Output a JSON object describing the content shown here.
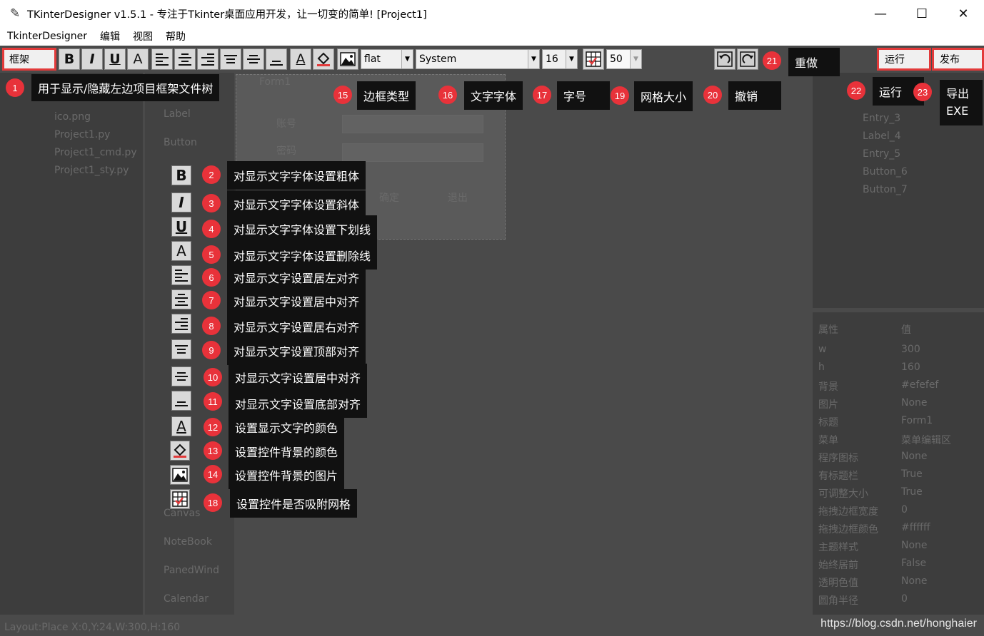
{
  "window": {
    "title": "TKinterDesigner v1.5.1 - 专注于Tkinter桌面应用开发，让一切变的简单!   [Project1]",
    "minimize": "—",
    "maximize": "☐",
    "close": "✕"
  },
  "menu": [
    "TkinterDesigner",
    "编辑",
    "视图",
    "帮助"
  ],
  "toolbar": {
    "frame_btn": "框架",
    "bold": "B",
    "italic": "I",
    "underline": "U",
    "strike": "A",
    "font_color": "A",
    "border_value": "flat",
    "font_value": "System",
    "size_value": "16",
    "grid_value": "50",
    "run_btn": "运行",
    "publish_btn": "发布"
  },
  "form": {
    "title": "Form1",
    "account_label": "账号",
    "password_label": "密码",
    "ok_btn": "确定",
    "exit_btn": "退出"
  },
  "left_tree": [
    "ico.png",
    "Project1.py",
    "Project1_cmd.py",
    "Project1_sty.py"
  ],
  "widgets": [
    "Label",
    "Button",
    "Canvas",
    "NoteBook",
    "PanedWind",
    "Calendar"
  ],
  "right_tree": [
    "Entry_3",
    "Label_4",
    "Entry_5",
    "Button_6",
    "Button_7"
  ],
  "properties": {
    "header_name": "属性",
    "header_value": "值",
    "rows": [
      {
        "k": "w",
        "v": "300"
      },
      {
        "k": "h",
        "v": "160"
      },
      {
        "k": "背景",
        "v": "#efefef"
      },
      {
        "k": "图片",
        "v": "None"
      },
      {
        "k": "标题",
        "v": "Form1"
      },
      {
        "k": "菜单",
        "v": "菜单编辑区"
      },
      {
        "k": "程序图标",
        "v": "None"
      },
      {
        "k": "有标题栏",
        "v": "True"
      },
      {
        "k": "可调整大小",
        "v": "True"
      },
      {
        "k": "拖拽边框宽度",
        "v": "0"
      },
      {
        "k": "拖拽边框颜色",
        "v": "#ffffff"
      },
      {
        "k": "主题样式",
        "v": "None"
      },
      {
        "k": "始终居前",
        "v": "False"
      },
      {
        "k": "透明色值",
        "v": "None"
      },
      {
        "k": "圆角半径",
        "v": "0"
      }
    ]
  },
  "status": "Layout:Place   X:0,Y:24,W:300,H:160",
  "watermark": "https://blog.csdn.net/honghaier",
  "callouts": {
    "c1": {
      "num": "1",
      "text": "用于显示/隐藏左边项目框架文件树"
    },
    "c2": {
      "num": "2",
      "text": "对显示文字字体设置粗体"
    },
    "c3": {
      "num": "3",
      "text": "对显示文字字体设置斜体"
    },
    "c4": {
      "num": "4",
      "text": "对显示文字字体设置下划线"
    },
    "c5": {
      "num": "5",
      "text": "对显示文字字体设置删除线"
    },
    "c6": {
      "num": "6",
      "text": "对显示文字设置居左对齐"
    },
    "c7": {
      "num": "7",
      "text": "对显示文字设置居中对齐"
    },
    "c8": {
      "num": "8",
      "text": "对显示文字设置居右对齐"
    },
    "c9": {
      "num": "9",
      "text": "对显示文字设置顶部对齐"
    },
    "c10": {
      "num": "10",
      "text": "对显示文字设置居中对齐"
    },
    "c11": {
      "num": "11",
      "text": "对显示文字设置底部对齐"
    },
    "c12": {
      "num": "12",
      "text": "设置显示文字的颜色"
    },
    "c13": {
      "num": "13",
      "text": "设置控件背景的颜色"
    },
    "c14": {
      "num": "14",
      "text": "设置控件背景的图片"
    },
    "c15": {
      "num": "15",
      "text": "边框类型"
    },
    "c16": {
      "num": "16",
      "text": "文字字体"
    },
    "c17": {
      "num": "17",
      "text": "字号"
    },
    "c18": {
      "num": "18",
      "text": "设置控件是否吸附网格"
    },
    "c19": {
      "num": "19",
      "text": "网格大小"
    },
    "c20": {
      "num": "20",
      "text": "撤销"
    },
    "c21": {
      "num": "21",
      "text": "重做"
    },
    "c22": {
      "num": "22",
      "text": "运行"
    },
    "c23": {
      "num": "23",
      "text": "导出\nEXE"
    }
  },
  "colors": {
    "badge": "#e8323a",
    "callout_bg": "#111111",
    "highlight": "#e23a3a"
  }
}
